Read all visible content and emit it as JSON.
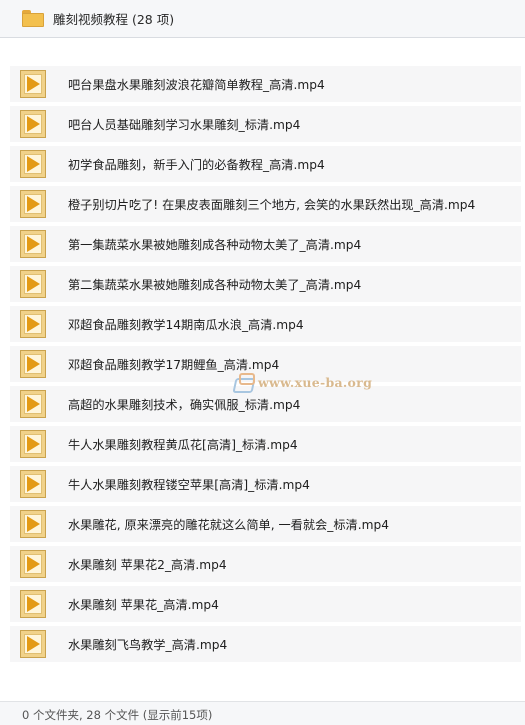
{
  "header": {
    "title": "雕刻视频教程 (28 项)",
    "icon": "folder-icon"
  },
  "files": [
    {
      "name": "吧台果盘水果雕刻波浪花瓣简单教程_高清.mp4",
      "icon": "video-file-icon"
    },
    {
      "name": "吧台人员基础雕刻学习水果雕刻_标清.mp4",
      "icon": "video-file-icon"
    },
    {
      "name": "初学食品雕刻，新手入门的必备教程_高清.mp4",
      "icon": "video-file-icon"
    },
    {
      "name": "橙子别切片吃了! 在果皮表面雕刻三个地方, 会笑的水果跃然出现_高清.mp4",
      "icon": "video-file-icon"
    },
    {
      "name": "第一集蔬菜水果被她雕刻成各种动物太美了_高清.mp4",
      "icon": "video-file-icon"
    },
    {
      "name": "第二集蔬菜水果被她雕刻成各种动物太美了_高清.mp4",
      "icon": "video-file-icon"
    },
    {
      "name": "邓超食品雕刻教学14期南瓜水浪_高清.mp4",
      "icon": "video-file-icon"
    },
    {
      "name": "邓超食品雕刻教学17期鲤鱼_高清.mp4",
      "icon": "video-file-icon"
    },
    {
      "name": "高超的水果雕刻技术，确实佩服_标清.mp4",
      "icon": "video-file-icon"
    },
    {
      "name": "牛人水果雕刻教程黄瓜花[高清]_标清.mp4",
      "icon": "video-file-icon"
    },
    {
      "name": "牛人水果雕刻教程镂空苹果[高清]_标清.mp4",
      "icon": "video-file-icon"
    },
    {
      "name": "水果雕花, 原来漂亮的雕花就这么简单, 一看就会_标清.mp4",
      "icon": "video-file-icon"
    },
    {
      "name": "水果雕刻 苹果花2_高清.mp4",
      "icon": "video-file-icon"
    },
    {
      "name": "水果雕刻 苹果花_高清.mp4",
      "icon": "video-file-icon"
    },
    {
      "name": "水果雕刻飞鸟教学_高清.mp4",
      "icon": "video-file-icon"
    }
  ],
  "watermark": {
    "text": "www.xue-ba.org"
  },
  "footer": {
    "status": "0 个文件夹, 28 个文件 (显示前15项)"
  },
  "colors": {
    "folder": "#f3c04e",
    "play": "#e39a16",
    "row_bg": "#f6f6f7",
    "header_bg": "#f6f7f9"
  }
}
